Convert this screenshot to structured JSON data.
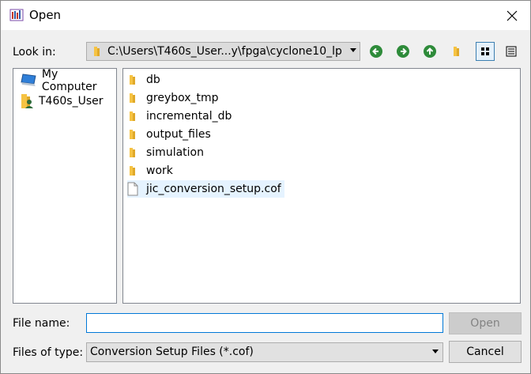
{
  "window": {
    "title": "Open"
  },
  "toolbar": {
    "lookin_label": "Look in:",
    "path": "C:\\Users\\T460s_User...y\\fpga\\cyclone10_lp",
    "back_icon": "back-arrow-icon",
    "forward_icon": "forward-arrow-icon",
    "up_icon": "up-arrow-icon",
    "new_folder_icon": "new-folder-icon",
    "view_icons": "detail-view-icon",
    "view_list": "list-view-icon"
  },
  "sidebar": {
    "items": [
      {
        "label": "My Computer",
        "icon": "computer-icon"
      },
      {
        "label": "T460s_User",
        "icon": "user-icon"
      }
    ]
  },
  "files": [
    {
      "name": "db",
      "type": "folder"
    },
    {
      "name": "greybox_tmp",
      "type": "folder"
    },
    {
      "name": "incremental_db",
      "type": "folder"
    },
    {
      "name": "output_files",
      "type": "folder"
    },
    {
      "name": "simulation",
      "type": "folder"
    },
    {
      "name": "work",
      "type": "folder"
    },
    {
      "name": "jic_conversion_setup.cof",
      "type": "file"
    }
  ],
  "form": {
    "filename_label": "File name:",
    "filename_value": "",
    "open_label": "Open",
    "filetype_label": "Files of type:",
    "filetype_value": "Conversion Setup Files (*.cof)",
    "cancel_label": "Cancel"
  },
  "colors": {
    "accent": "#0078d7",
    "nav_green": "#2e8b3a",
    "folder": "#f6c343"
  }
}
